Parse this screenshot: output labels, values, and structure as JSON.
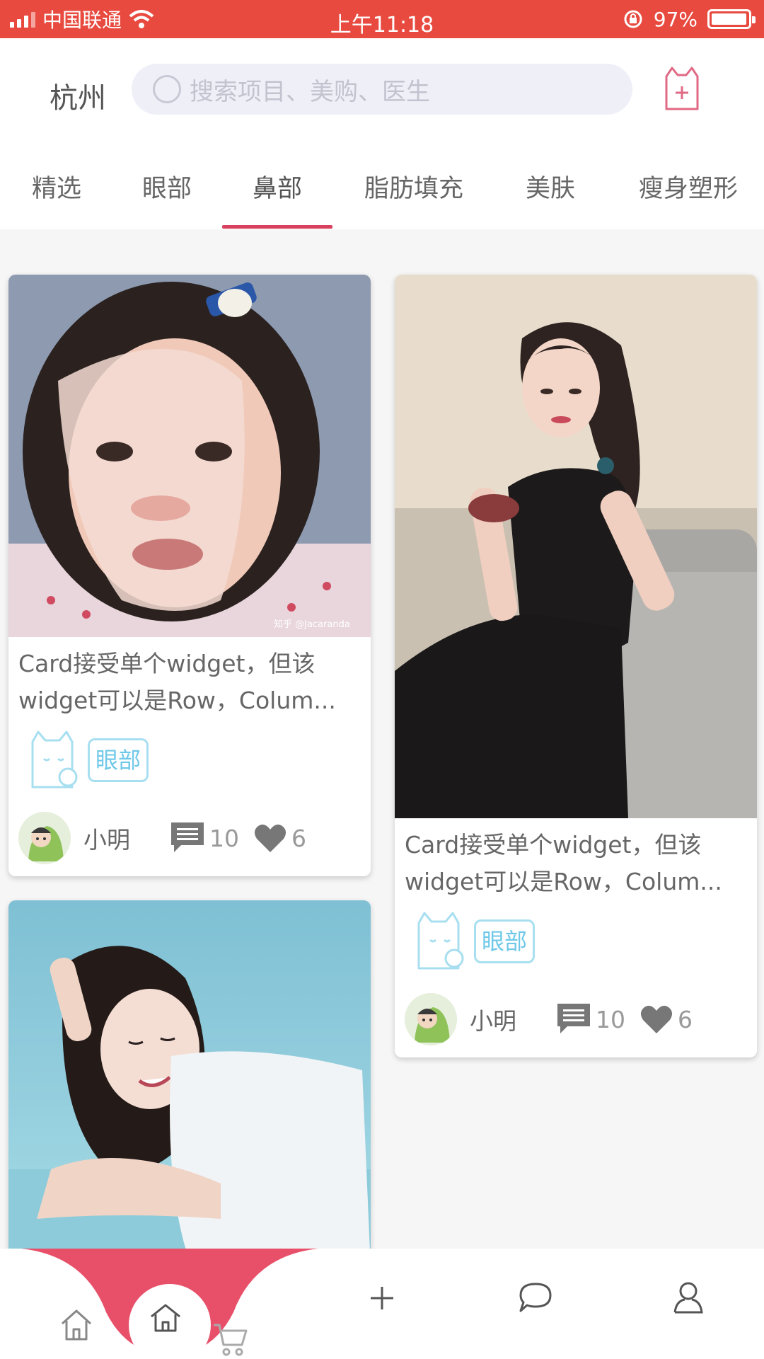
{
  "status_bar": {
    "carrier": "中国联通",
    "time": "上午11:18",
    "battery": "97%",
    "battery_level": 0.97
  },
  "header": {
    "city": "杭州",
    "search_placeholder": "搜索项目、美购、医生"
  },
  "tabs": [
    {
      "label": "精选"
    },
    {
      "label": "眼部"
    },
    {
      "label": "鼻部"
    },
    {
      "label": "脂肪填充"
    },
    {
      "label": "美肤"
    },
    {
      "label": "瘦身塑形"
    }
  ],
  "active_tab": "鼻部",
  "cards": [
    {
      "title": "Card接受单个widget，但该widget可以是Row，Colum...",
      "title_line1": "Card接受单个widget，但该",
      "title_line2": "widget可以是Row，Colum...",
      "tag": "眼部",
      "author": "小明",
      "comments": "10",
      "likes": "6",
      "image_watermark": "知乎 @Jacaranda"
    },
    {
      "title": "Card接受单个widget，但该widget可以是Row，Colum...",
      "title_line1": "Card接受单个widget，但该",
      "title_line2": "widget可以是Row，Colum...",
      "tag": "眼部",
      "author": "小明",
      "comments": "10",
      "likes": "6"
    }
  ],
  "colors": {
    "status_bar": "#e84a3f",
    "accent": "#d8415d",
    "tag": "#6fc8e8"
  },
  "bottom_nav": [
    "home-icon",
    "home-active-icon",
    "cart-icon",
    "plus-icon",
    "chat-icon",
    "profile-icon"
  ]
}
